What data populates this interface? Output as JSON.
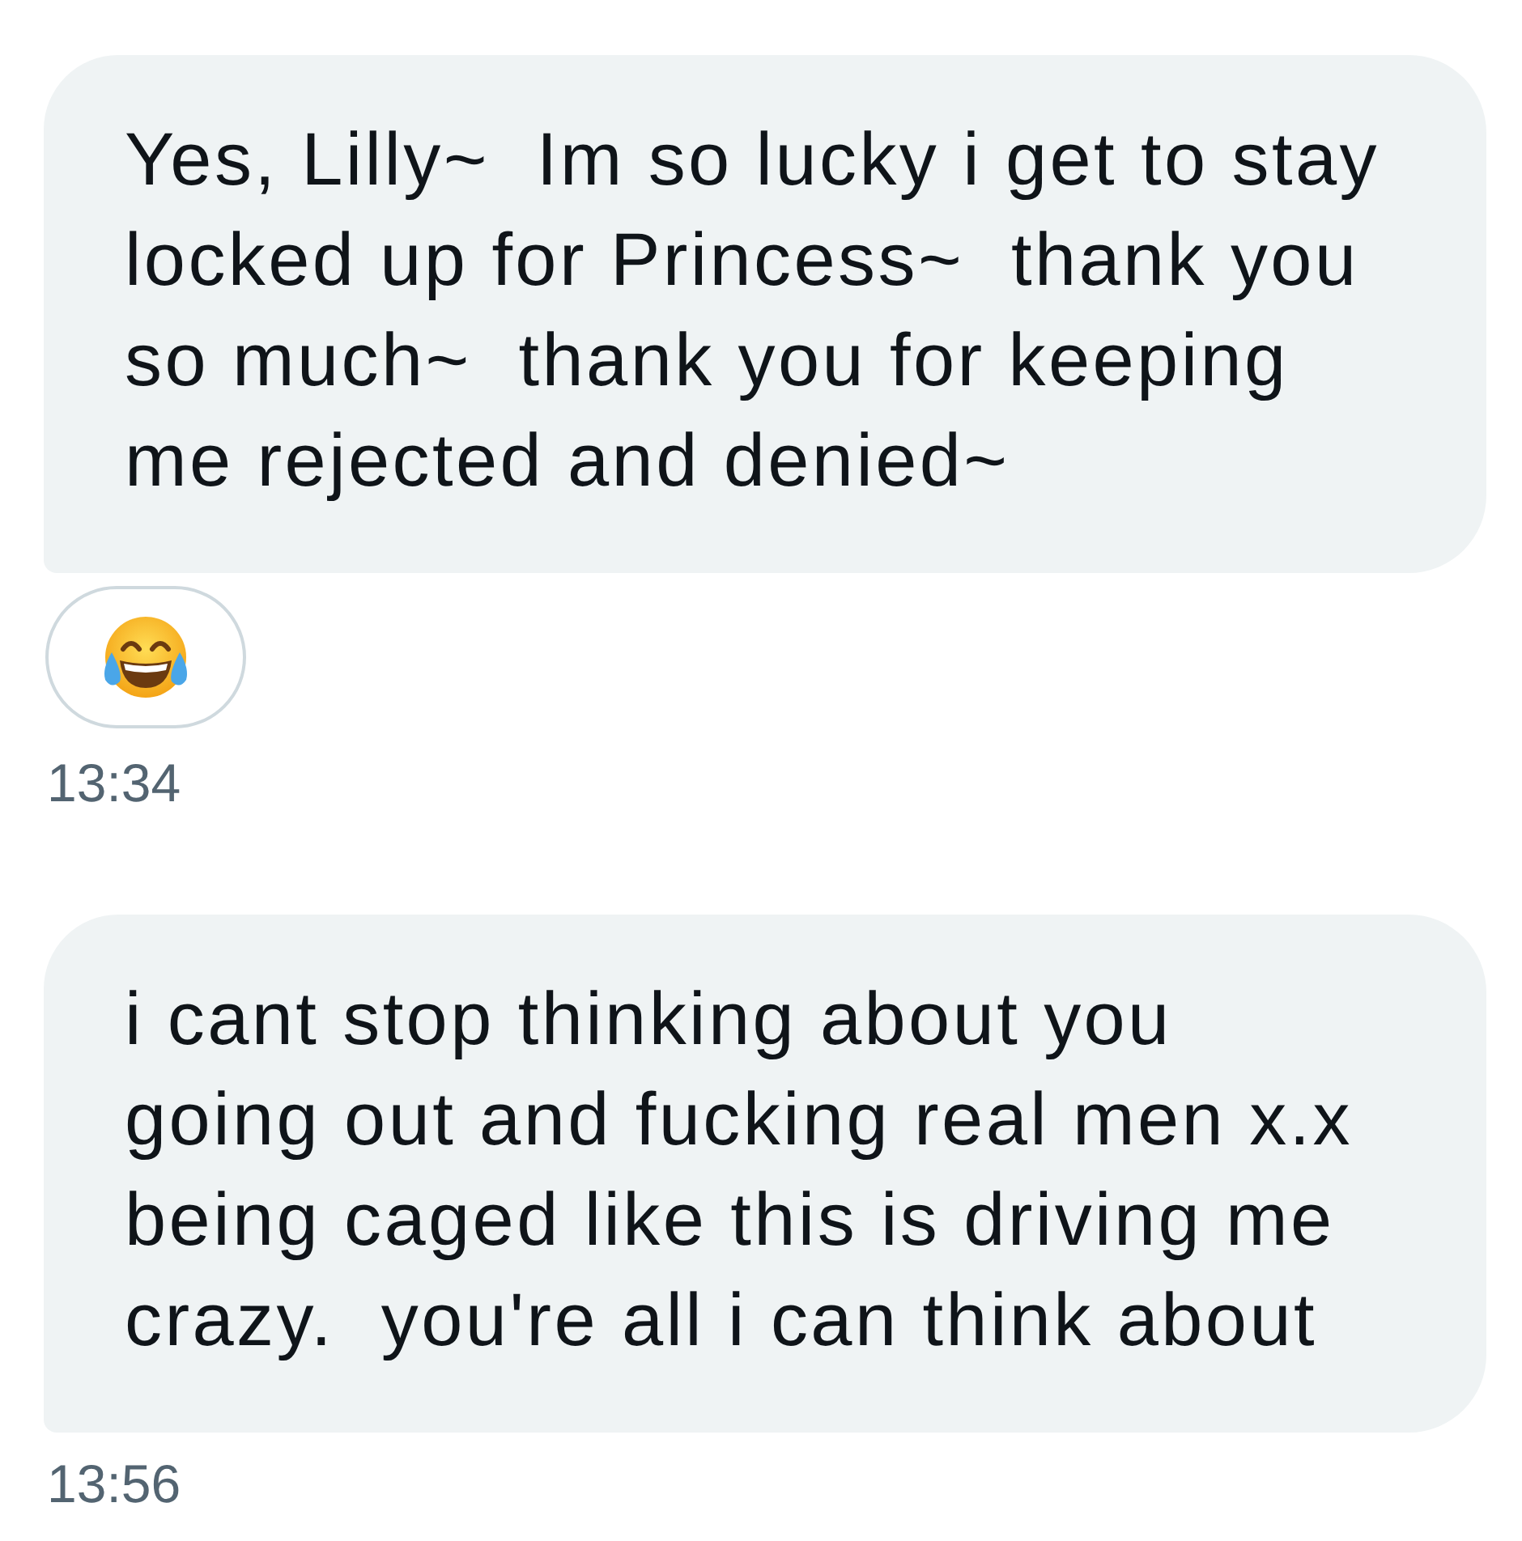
{
  "messages": [
    {
      "text": "Yes, Lilly~  Im so lucky i get to stay\nlocked up for Princess~  thank you\nso much~  thank you for keeping\nme rejected and denied~",
      "reactions": [
        {
          "kind": "tears_of_joy"
        }
      ],
      "time": "13:34"
    },
    {
      "text": "i cant stop thinking about you\ngoing out and fucking real men x.x\nbeing caged like this is driving me\ncrazy.  you're all i can think about",
      "time": "13:56"
    }
  ]
}
